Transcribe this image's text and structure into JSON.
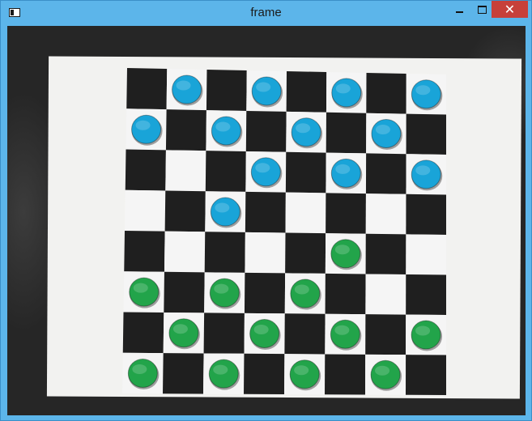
{
  "window": {
    "title": "frame",
    "controls": {
      "minimize_icon": "minimize-icon",
      "maximize_icon": "maximize-icon",
      "close_icon": "close-icon",
      "close_glyph": "✕"
    }
  },
  "board": {
    "size": 8,
    "colors": {
      "dark": "#1f1f1f",
      "light": "#f5f5f5",
      "blue": "#19a4d8",
      "green": "#22a44a"
    },
    "pieces": [
      {
        "row": 0,
        "col": 1,
        "color": "blue"
      },
      {
        "row": 0,
        "col": 3,
        "color": "blue"
      },
      {
        "row": 0,
        "col": 5,
        "color": "blue"
      },
      {
        "row": 0,
        "col": 7,
        "color": "blue"
      },
      {
        "row": 1,
        "col": 0,
        "color": "blue"
      },
      {
        "row": 1,
        "col": 2,
        "color": "blue"
      },
      {
        "row": 1,
        "col": 4,
        "color": "blue"
      },
      {
        "row": 1,
        "col": 6,
        "color": "blue"
      },
      {
        "row": 2,
        "col": 3,
        "color": "blue"
      },
      {
        "row": 2,
        "col": 5,
        "color": "blue"
      },
      {
        "row": 2,
        "col": 7,
        "color": "blue"
      },
      {
        "row": 3,
        "col": 2,
        "color": "blue"
      },
      {
        "row": 4,
        "col": 5,
        "color": "green"
      },
      {
        "row": 5,
        "col": 0,
        "color": "green"
      },
      {
        "row": 5,
        "col": 2,
        "color": "green"
      },
      {
        "row": 5,
        "col": 4,
        "color": "green"
      },
      {
        "row": 6,
        "col": 1,
        "color": "green"
      },
      {
        "row": 6,
        "col": 3,
        "color": "green"
      },
      {
        "row": 6,
        "col": 5,
        "color": "green"
      },
      {
        "row": 6,
        "col": 7,
        "color": "green"
      },
      {
        "row": 7,
        "col": 0,
        "color": "green"
      },
      {
        "row": 7,
        "col": 2,
        "color": "green"
      },
      {
        "row": 7,
        "col": 4,
        "color": "green"
      },
      {
        "row": 7,
        "col": 6,
        "color": "green"
      }
    ]
  }
}
